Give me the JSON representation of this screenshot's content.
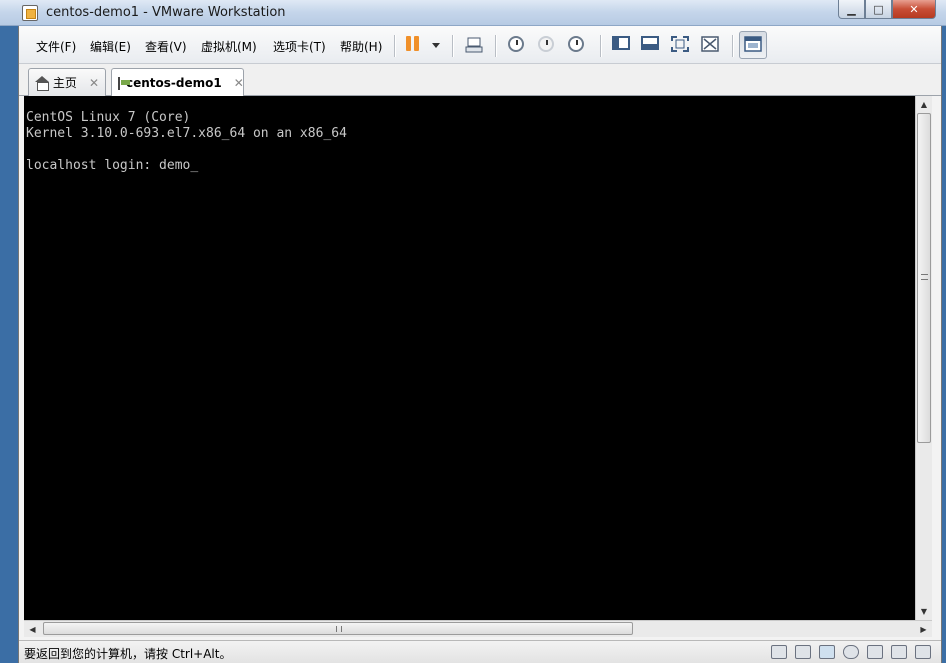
{
  "window": {
    "title": "centos-demo1 - VMware Workstation",
    "controls": {
      "minimize": "▁",
      "maximize": "□",
      "close": "✕"
    }
  },
  "menu": {
    "file": "文件(F)",
    "edit": "编辑(E)",
    "view": "查看(V)",
    "vm": "虚拟机(M)",
    "tabs": "选项卡(T)",
    "help": "帮助(H)"
  },
  "toolbar_icons": [
    "pause-icon",
    "dropdown-arrow-icon",
    "send-ctrl-alt-del-icon",
    "snapshot-take-icon",
    "snapshot-revert-icon",
    "snapshot-manager-icon",
    "show-library-icon",
    "thumbnail-bar-icon",
    "full-screen-icon",
    "unity-icon",
    "console-view-icon"
  ],
  "tabs": [
    {
      "label": "主页",
      "icon": "home-icon",
      "close": "✕"
    },
    {
      "label": "centos-demo1",
      "icon": "vm-icon",
      "close": "✕"
    }
  ],
  "console": {
    "lines": [
      "CentOS Linux 7 (Core)",
      "Kernel 3.10.0-693.el7.x86_64 on an x86_64",
      "",
      "localhost login: demo"
    ],
    "cursor": "_"
  },
  "scrollbars": {
    "up": "▲",
    "down": "▼",
    "left": "◀",
    "right": "▶"
  },
  "status": {
    "text": "要返回到您的计算机，请按 Ctrl+Alt。",
    "device_icons": [
      "hard-disk-icon",
      "cd-drive-icon",
      "network-icon",
      "usb-icon",
      "sound-icon",
      "printer-icon",
      "display-icon"
    ]
  }
}
